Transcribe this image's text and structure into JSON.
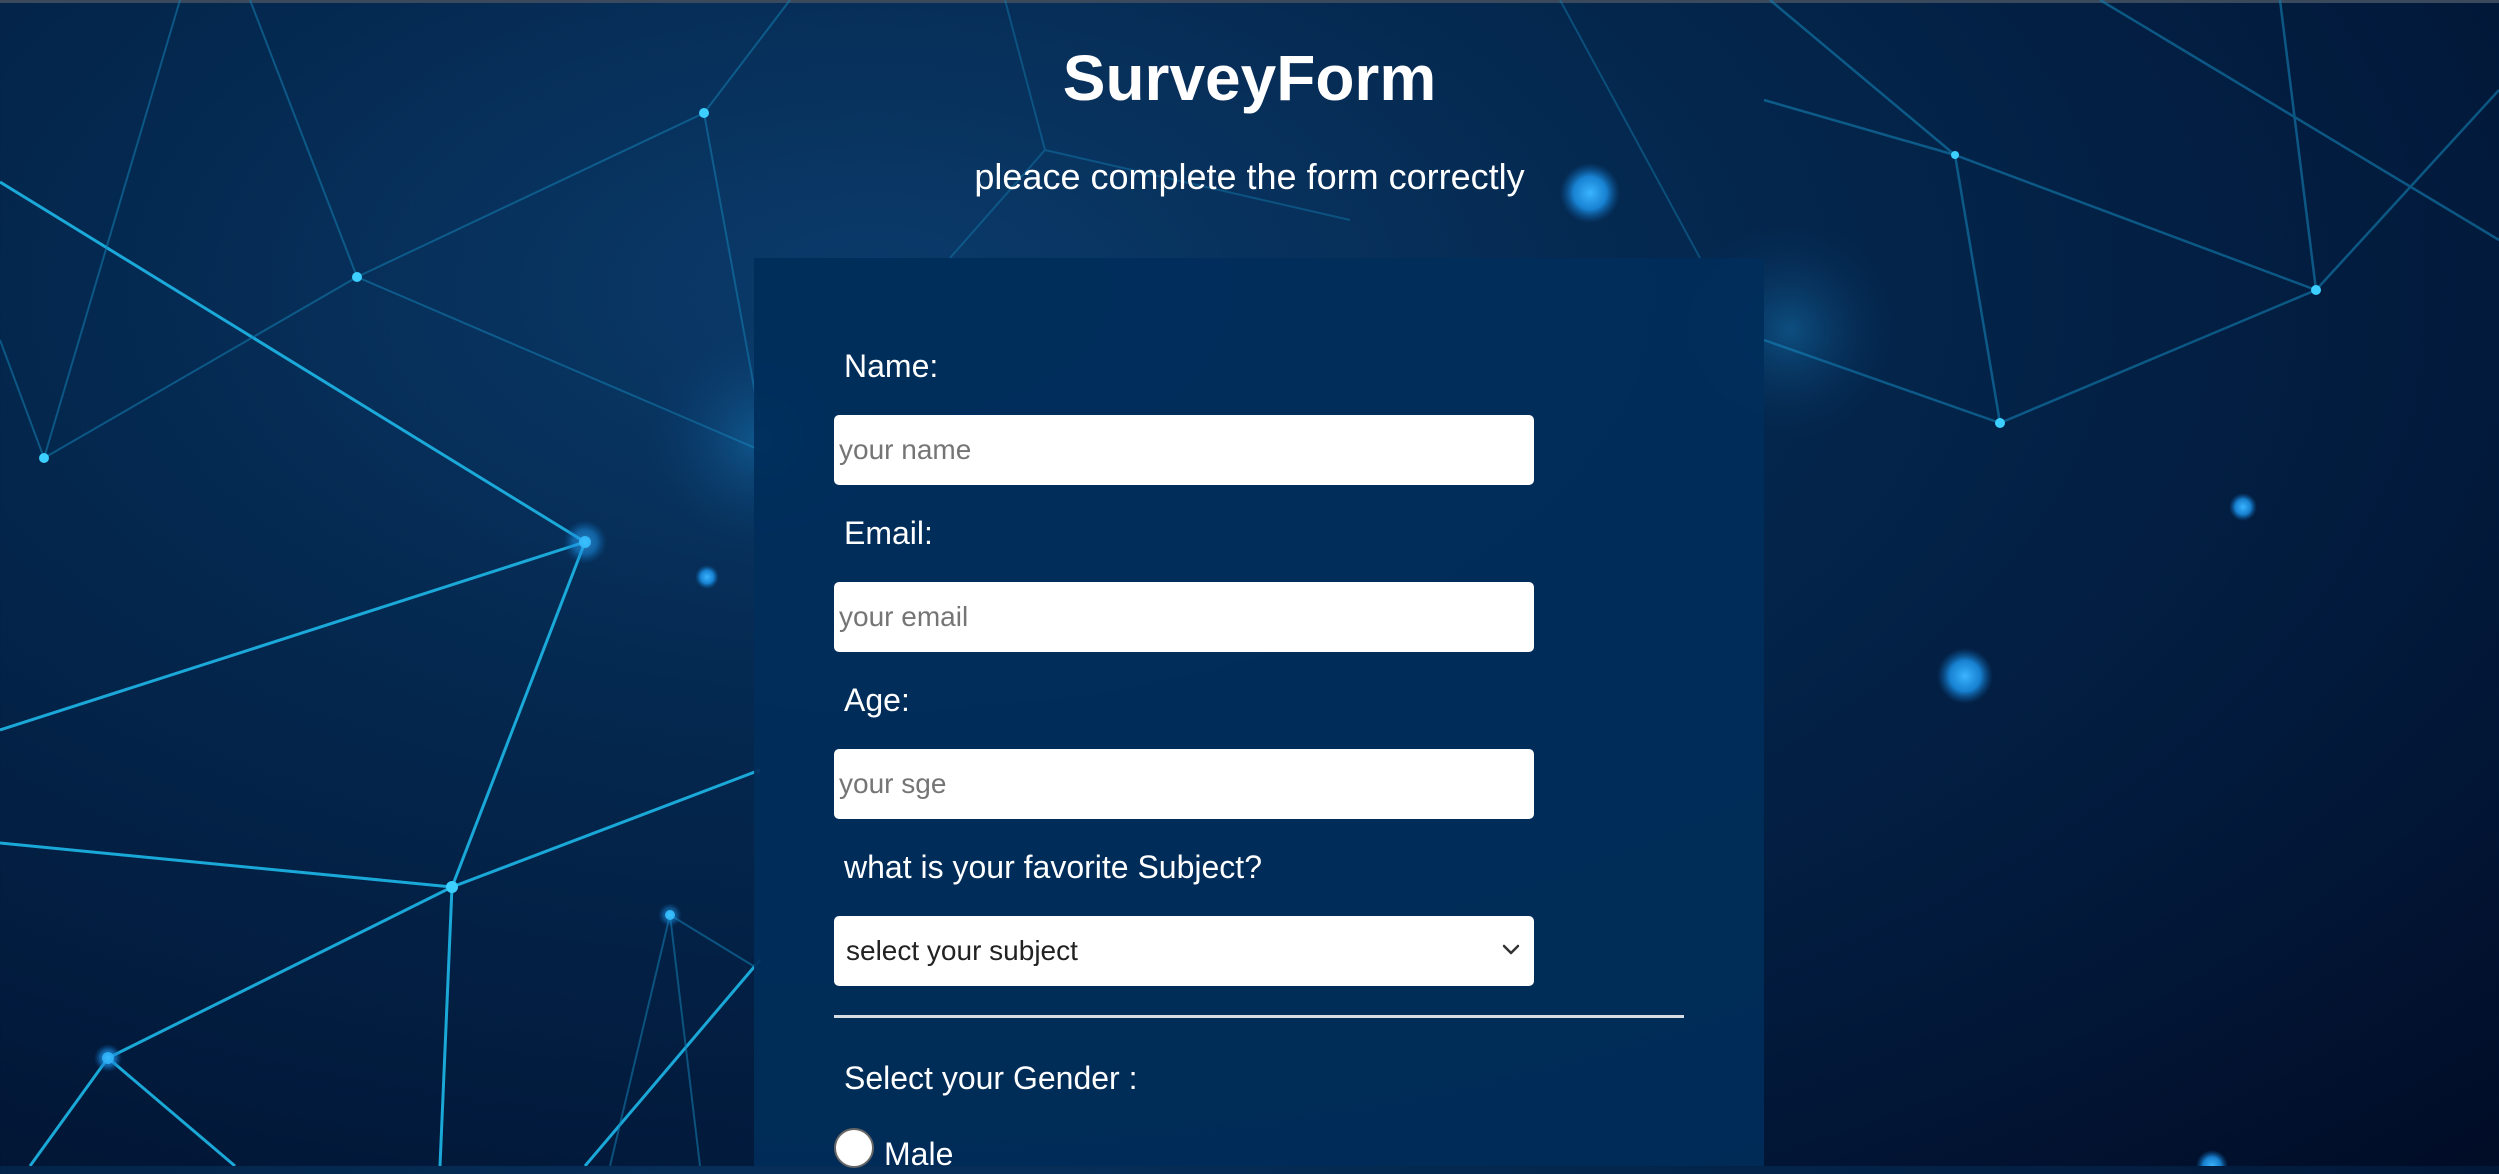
{
  "header": {
    "title": "SurveyForm",
    "subtitle": "pleace complete the form correctly"
  },
  "form": {
    "name": {
      "label": "Name:",
      "placeholder": "your name",
      "value": ""
    },
    "email": {
      "label": "Email:",
      "placeholder": "your email",
      "value": ""
    },
    "age": {
      "label": "Age:",
      "placeholder": "your sge",
      "value": ""
    },
    "subject": {
      "label": "what is your favorite Subject?",
      "selected": "select your subject"
    },
    "gender": {
      "label": "Select your Gender :",
      "options": [
        {
          "label": "Male",
          "checked": false
        }
      ]
    }
  },
  "colors": {
    "background": "#021a3c",
    "panel": "#002d5a",
    "accent_lines": "#1fb4e6",
    "text": "#ffffff"
  },
  "icons": {
    "select_arrow": "chevron-down-icon"
  }
}
